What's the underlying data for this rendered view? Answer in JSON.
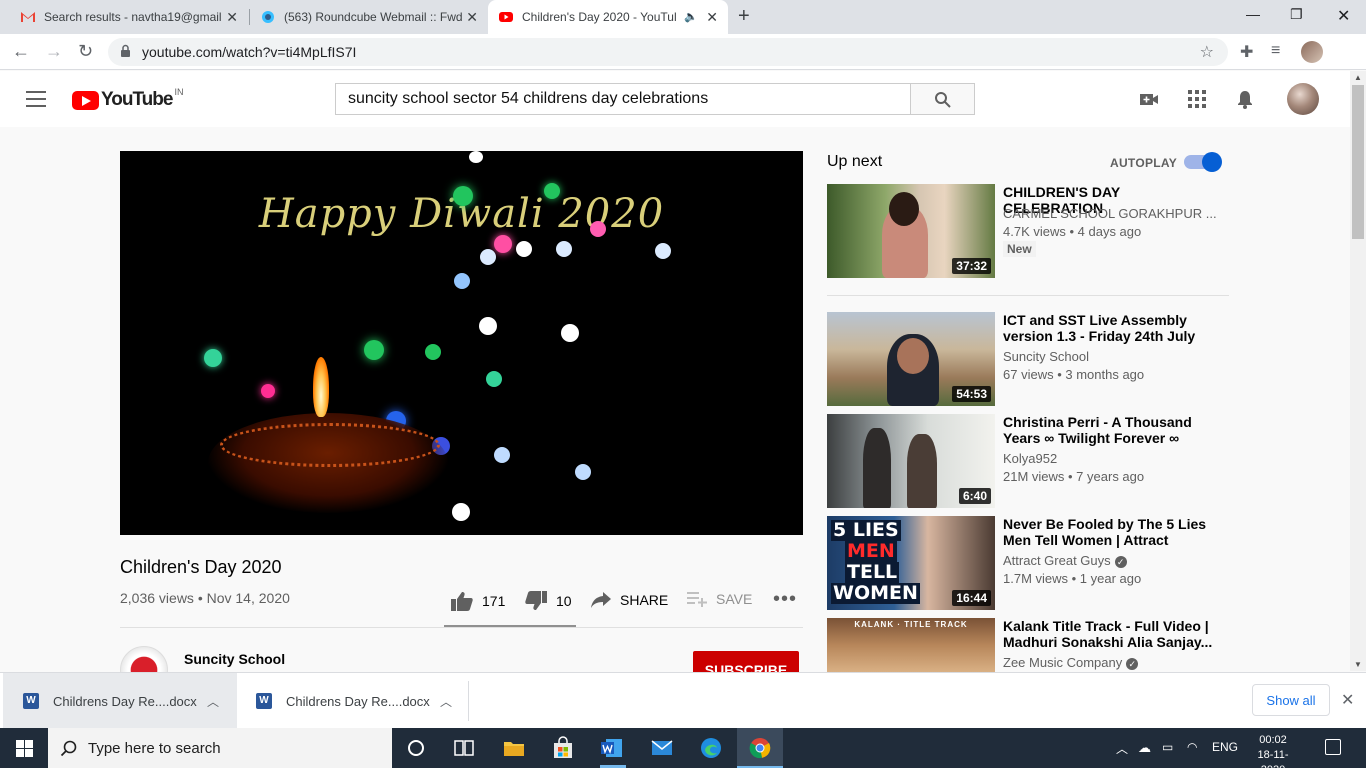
{
  "browser": {
    "tabs": [
      {
        "title": "Search results - navtha19@gmail",
        "favicon": "gmail-icon"
      },
      {
        "title": "(563) Roundcube Webmail :: Fwd",
        "favicon": "roundcube-icon"
      },
      {
        "title": "Children's Day 2020 - YouTul",
        "favicon": "youtube-icon",
        "active": true
      }
    ],
    "url": "youtube.com/watch?v=ti4MpLfIS7I"
  },
  "youtube": {
    "logo_text": "YouTube",
    "region": "IN",
    "search_value": "suncity school sector 54  childrens day celebrations"
  },
  "video": {
    "overlay_text": "Happy Diwali 2020",
    "title": "Children's Day 2020",
    "meta": "2,036 views • Nov 14, 2020",
    "likes": "171",
    "dislikes": "10",
    "share_label": "SHARE",
    "save_label": "SAVE",
    "like_ratio": 0.945,
    "channel_name": "Suncity School",
    "subscribe_label": "SUBSCRIBE"
  },
  "sidebar": {
    "upnext_label": "Up next",
    "autoplay_label": "AUTOPLAY",
    "autoplay_on": true,
    "recommendations": [
      {
        "title": "CHILDREN'S DAY CELEBRATION",
        "channel": "CARMEL SCHOOL GORAKHPUR ...",
        "views": "4.7K views • 4 days ago",
        "duration": "37:32",
        "badge": "New",
        "verified": false
      },
      {
        "title": "ICT and SST Live Assembly version 1.3 - Friday 24th July",
        "channel": "Suncity School",
        "views": "67 views • 3 months ago",
        "duration": "54:53",
        "verified": false
      },
      {
        "title": "Christina Perri - A Thousand Years ∞ Twilight Forever ∞",
        "channel": "Kolya952",
        "views": "21M views • 7 years ago",
        "duration": "6:40",
        "verified": false
      },
      {
        "title": "Never Be Fooled by The 5 Lies Men Tell Women | Attract Grea...",
        "channel": "Attract Great Guys",
        "views": "1.7M views • 1 year ago",
        "duration": "16:44",
        "verified": true,
        "thumb_text": [
          "5 LIES",
          "MEN",
          "TELL",
          "WOMEN"
        ]
      },
      {
        "title": "Kalank Title Track - Full Video | Madhuri Sonakshi Alia Sanjay...",
        "channel": "Zee Music Company",
        "views": "",
        "duration": "",
        "verified": true,
        "thumb_text": [
          "KALANK · TITLE TRACK"
        ]
      }
    ]
  },
  "downloads": {
    "items": [
      "Childrens Day Re....docx",
      "Childrens Day Re....docx"
    ],
    "show_all_label": "Show all"
  },
  "taskbar": {
    "search_placeholder": "Type here to search",
    "lang": "ENG",
    "time": "00:02",
    "date": "18-11-2020"
  },
  "colors": {
    "youtube_red": "#ff0000",
    "subscribe_red": "#cc0000",
    "autoplay_blue": "#065fd4",
    "link_blue": "#1a73e8",
    "taskbar_bg": "#202c3a"
  }
}
